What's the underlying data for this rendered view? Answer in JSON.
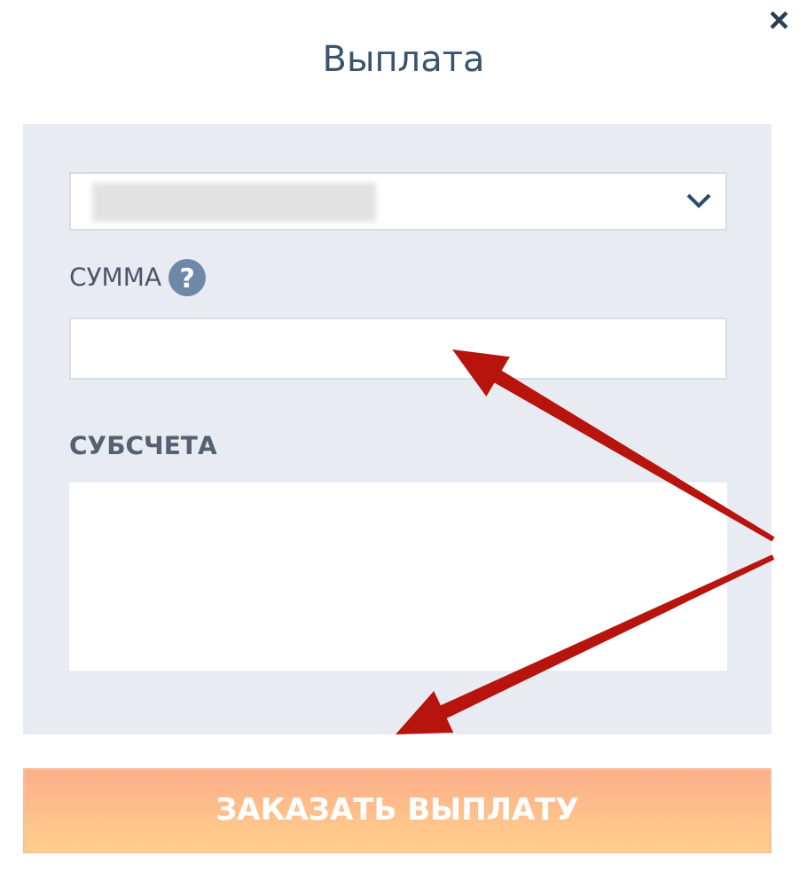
{
  "dialog": {
    "title": "Выплата",
    "close": "×"
  },
  "form": {
    "amount_label": "СУММА",
    "help": "?",
    "subaccounts_label": "СУБСЧЕТА"
  },
  "submit": "ЗАКАЗАТЬ ВЫПЛАТУ"
}
